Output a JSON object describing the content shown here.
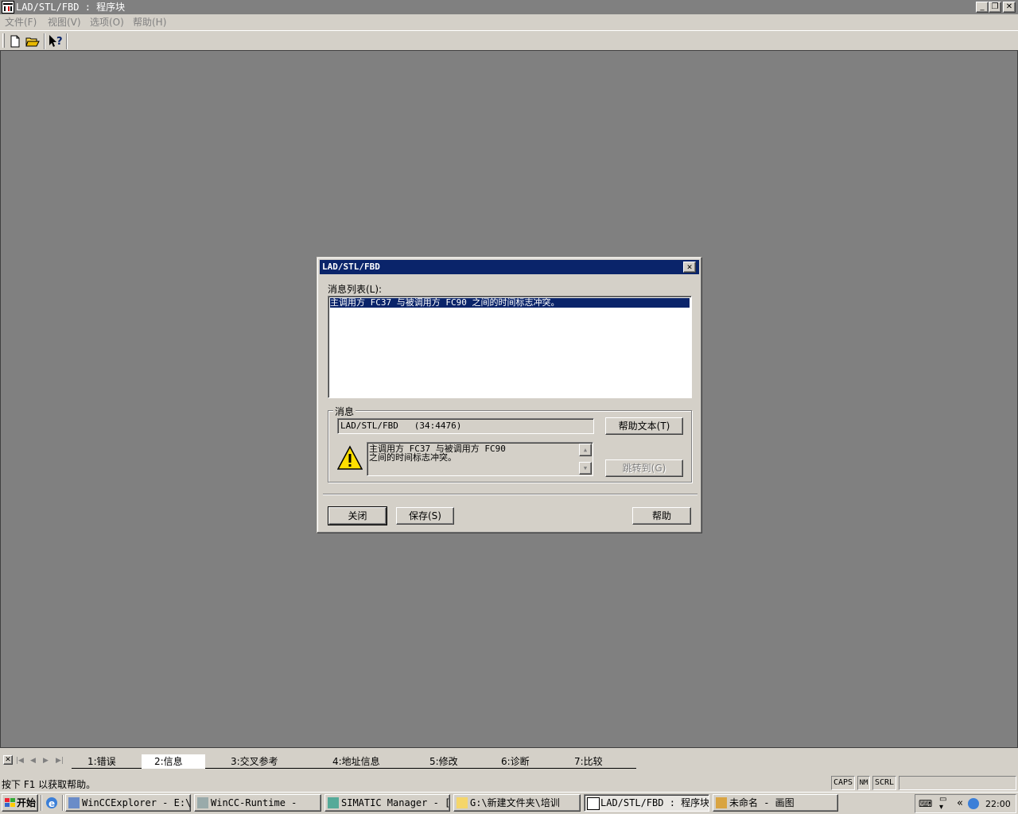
{
  "window": {
    "title": "LAD/STL/FBD : 程序块",
    "controls": {
      "minimize": "_",
      "restore": "❐",
      "close": "✕"
    }
  },
  "menu": [
    "文件(F)",
    "视图(V)",
    "选项(O)",
    "帮助(H)"
  ],
  "toolbar": {
    "new_icon": "new-document-icon",
    "open_icon": "open-folder-icon",
    "help_icon": "whats-this-help-icon"
  },
  "dialog": {
    "title": "LAD/STL/FBD",
    "message_list_label": "消息列表(L):",
    "message_list": [
      "主调用方 FC37 与被调用方 FC90 之间的时间标志冲突。"
    ],
    "group_label": "消息",
    "source": "LAD/STL/FBD   (34:4476)",
    "help_text_button": "帮助文本(T)",
    "detail_line1": "主调用方 FC37 与被调用方 FC90",
    "detail_line2": "之间的时间标志冲突。",
    "goto_button": "跳转到(G)",
    "close_button": "关闭",
    "save_button": "保存(S)",
    "help_button": "帮助",
    "warning_icon": "warning-icon"
  },
  "tabs": [
    "1:错误",
    "2:信息",
    "3:交叉参考",
    "4:地址信息",
    "5:修改",
    "6:诊断",
    "7:比较"
  ],
  "active_tab": "2:信息",
  "status": {
    "text": "按下 F1 以获取帮助。",
    "caps": "CAPS",
    "num": "NM",
    "scrl": "SCRL"
  },
  "taskbar": {
    "start": "开始",
    "tasks": [
      "WinCCExplorer - E:\\...",
      "WinCC-Runtime -",
      "SIMATIC Manager - [...",
      "G:\\新建文件夹\\培训",
      "LAD/STL/FBD : 程序块",
      "未命名 - 画图"
    ],
    "active_task": "LAD/STL/FBD : 程序块",
    "clock": "22:00",
    "tray_chevron": "«"
  },
  "colors": {
    "titlebar_inactive": "#808080",
    "dialog_title": "#0a246a",
    "selection": "#0a246a",
    "workspace": "#808080",
    "face": "#d4d0c8"
  }
}
